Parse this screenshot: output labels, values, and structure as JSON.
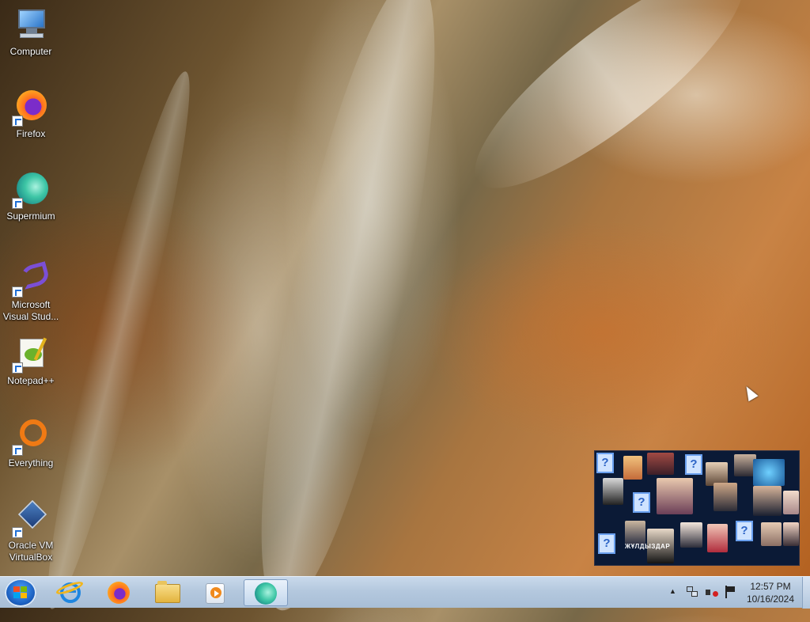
{
  "desktop": {
    "icons": [
      {
        "label": "Computer",
        "icon": "computer-icon"
      },
      {
        "label": "Firefox",
        "icon": "firefox-icon"
      },
      {
        "label": "Supermium",
        "icon": "supermium-icon"
      },
      {
        "label": "Microsoft Visual Stud...",
        "icon": "visual-studio-icon"
      },
      {
        "label": "Notepad++",
        "icon": "notepadpp-icon"
      },
      {
        "label": "Everything",
        "icon": "everything-icon"
      },
      {
        "label": "Oracle VM VirtualBox",
        "icon": "virtualbox-icon"
      }
    ]
  },
  "preview": {
    "caption": "ЖҰЛДЫЗДАР"
  },
  "taskbar": {
    "pinned": [
      {
        "name": "internet-explorer",
        "icon": "internet-explorer-icon"
      },
      {
        "name": "firefox",
        "icon": "firefox-icon"
      },
      {
        "name": "file-explorer",
        "icon": "folder-icon"
      },
      {
        "name": "media-player",
        "icon": "media-player-icon"
      },
      {
        "name": "supermium",
        "icon": "supermium-icon",
        "active": true
      }
    ],
    "tray": {
      "expand": "▲",
      "time": "12:57 PM",
      "date": "10/16/2024"
    }
  },
  "colors": {
    "taskbar": "#b4c8de",
    "start_orb": "#1b5fbf"
  }
}
